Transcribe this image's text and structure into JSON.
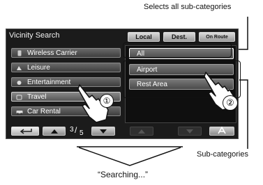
{
  "screen": {
    "title": "Vicinity Search",
    "tabs": [
      {
        "label": "Local"
      },
      {
        "label": "Dest."
      },
      {
        "label": "On Route"
      }
    ],
    "categories": [
      {
        "label": "Wireless Carrier",
        "icon": "phone-icon"
      },
      {
        "label": "Leisure",
        "icon": "leisure-icon"
      },
      {
        "label": "Entertainment",
        "icon": "entertainment-icon"
      },
      {
        "label": "Travel",
        "icon": "travel-icon"
      },
      {
        "label": "Car Rental",
        "icon": "car-icon"
      }
    ],
    "subcategories": [
      {
        "label": "All"
      },
      {
        "label": "Airport"
      },
      {
        "label": "Rest Area"
      }
    ],
    "pager": {
      "current": "3",
      "total": "5"
    }
  },
  "annotations": {
    "all_note": "Selects all sub-categories",
    "sub_note": "Sub-categories",
    "searching": "“Searching...”",
    "step1": "①",
    "step2": "②"
  },
  "colors": {
    "screen_bg": "#1b1b1b",
    "button_grad_top": "#6a6a6a",
    "button_grad_bottom": "#3e3e3e"
  }
}
